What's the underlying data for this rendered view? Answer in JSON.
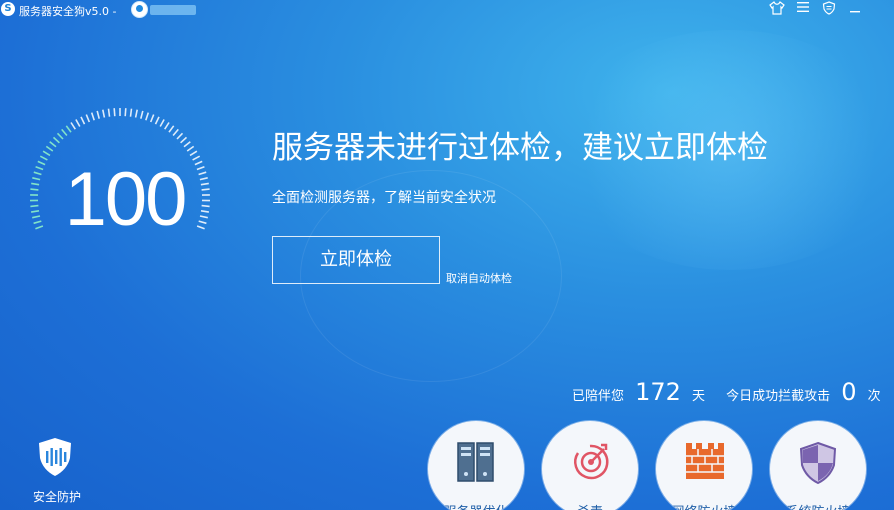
{
  "titlebar": {
    "app_title": "服务器安全狗v5.0 -",
    "logo_glyph": "S",
    "icons": [
      "shirt-icon",
      "menu-icon",
      "shield-icon",
      "minimize-icon"
    ]
  },
  "score": {
    "value": "100"
  },
  "headline": "服务器未进行过体检，建议立即体检",
  "subline": "全面检测服务器，了解当前安全状况",
  "check_button": "立即体检",
  "cancel_auto_check": "取消自动体检",
  "stats": {
    "accompanied_prefix": "已陪伴您",
    "accompanied_days": "172",
    "accompanied_unit": "天",
    "blocked_prefix": "今日成功拦截攻击",
    "blocked_count": "0",
    "blocked_unit": "次"
  },
  "shield": {
    "label": "安全防护"
  },
  "modules": [
    {
      "icon": "server-rack-icon",
      "label": "服务器优化"
    },
    {
      "icon": "target-icon",
      "label": "杀毒"
    },
    {
      "icon": "firewall-icon",
      "label": "网络防火墙"
    },
    {
      "icon": "shield-icon",
      "label": "系统防火墙"
    }
  ],
  "colors": {
    "background": "#1d6fd6",
    "accent": "#2a8fe0",
    "circle_bg": "#f4f7fb",
    "firewall": "#e8692c",
    "target": "#e05565",
    "shield_purple": "#7b64b0"
  }
}
